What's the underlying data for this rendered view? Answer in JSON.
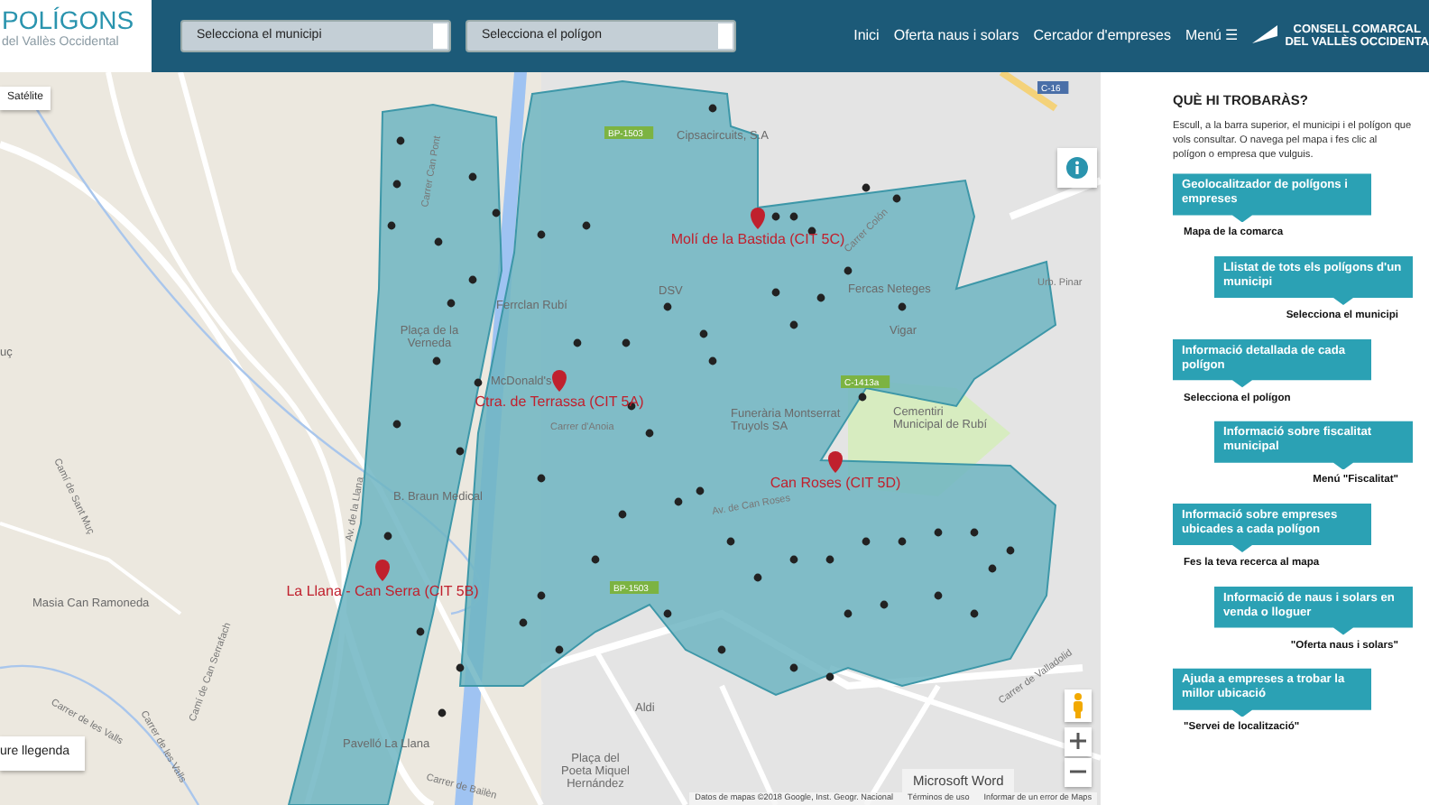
{
  "header": {
    "logo": {
      "title": "POLÍGONS",
      "subtitle": "del Vallès Occidental"
    },
    "selects": [
      {
        "value": "Selecciona el municipi"
      },
      {
        "value": "Selecciona el polígon"
      }
    ],
    "nav": [
      {
        "label": "Inici"
      },
      {
        "label": "Oferta naus i solars"
      },
      {
        "label": "Cercador d'empreses"
      },
      {
        "label": "Menú ☰"
      }
    ],
    "council_logo": [
      "CONSELL COMARCAL",
      "DEL VALLÈS OCCIDENTA"
    ]
  },
  "map": {
    "map_type_button": "Satélite",
    "legend_button": "ure llegenda",
    "polygons": [
      {
        "label": "Molí de la Bastida (CIT 5C)"
      },
      {
        "label": "Ctra. de Terrassa (CIT 5A)"
      },
      {
        "label": "Can Roses (CIT 5D)"
      },
      {
        "label": "La Llana - Can Serra (CIT 5B)"
      }
    ],
    "places": [
      "Cipsacircuits, S.A",
      "Ferrclan Rubí",
      "DSV",
      "Fercas Neteges",
      "Vigar",
      "McDonald's",
      "Plaça de la Verneda",
      "B. Braun Medical",
      "Funerària Montserrat Truyols SA",
      "Cementiri Municipal de Rubí",
      "Masia Can Ramoneda",
      "Pavelló La Llana",
      "Plaça del Poeta Miquel Hernández",
      "Aldi",
      "uç"
    ],
    "streets": [
      "Carrer Can Pont",
      "Camí de Sant Muç",
      "Carrer de les Valls",
      "Carrer de les Valls",
      "Camí de Can Serrafach",
      "Av. de la Llana",
      "Carrer d'Anoia",
      "Av. de Can Roses",
      "Carrer Colón",
      "Carrer de Valladolid",
      "Carrer de Bailèn",
      "Urb. Pinar"
    ],
    "road_signs": [
      "C-16",
      "BP-1503",
      "BP-1503",
      "C-1413a"
    ],
    "popup": "Microsoft Word",
    "attribution": [
      "Datos de mapas ©2018 Google, Inst. Geogr. Nacional",
      "Términos de uso",
      "Informar de un error de Maps"
    ]
  },
  "panel": {
    "title": "QUÈ HI TROBARÀS?",
    "intro": "Escull, a la barra superior, el municipi i el polígon que vols consultar. O navega pel mapa i fes clic al polígon o empresa que vulguis.",
    "items": [
      {
        "text": "Geolocalitzador de polígons i empreses",
        "caption": "Mapa de la comarca",
        "kind": "left"
      },
      {
        "text": "Llistat de tots els polígons d'un municipi",
        "caption": "Selecciona el municipi",
        "kind": "right"
      },
      {
        "text": "Informació detallada de cada polígon",
        "caption": "Selecciona el polígon",
        "kind": "left"
      },
      {
        "text": "Informació sobre fiscalitat municipal",
        "caption": "Menú \"Fiscalitat\"",
        "kind": "right"
      },
      {
        "text": "Informació sobre empreses ubicades a cada polígon",
        "caption": "Fes la teva recerca al mapa",
        "kind": "left"
      },
      {
        "text": "Informació de naus i solars en venda o lloguer",
        "caption": "\"Oferta naus i solars\"",
        "kind": "right"
      },
      {
        "text": "Ajuda a empreses a trobar la millor ubicació",
        "caption": "\"Servei de localització\"",
        "kind": "left"
      }
    ]
  }
}
